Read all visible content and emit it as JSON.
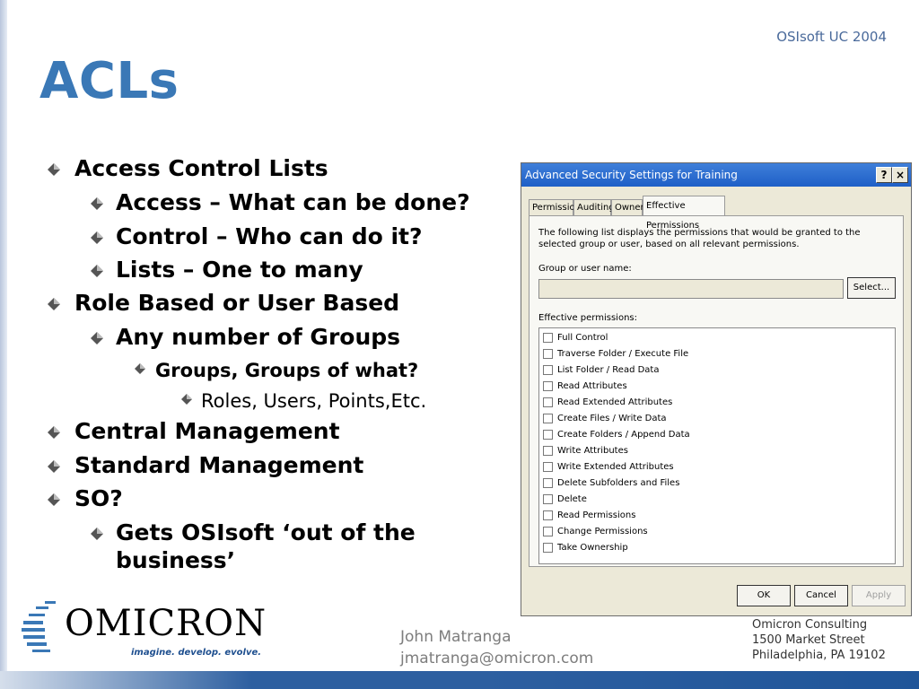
{
  "header": {
    "corner": "OSIsoft UC 2004",
    "title": "ACLs"
  },
  "bullets": {
    "b1": "Access Control Lists",
    "b1a": "Access – What can be done?",
    "b1b": "Control – Who can do it?",
    "b1c": "Lists – One to many",
    "b2": "Role Based or User Based",
    "b2a": "Any number of Groups",
    "b2a1": "Groups, Groups of what?",
    "b2a1a": "Roles, Users, Points,Etc.",
    "b3": "Central Management",
    "b4": "Standard Management",
    "b5": "SO?",
    "b5a_line1": "Gets OSIsoft ‘out of the",
    "b5a_line2": "business’"
  },
  "dialog": {
    "title": "Advanced Security Settings for Training",
    "help": "?",
    "close": "×",
    "tabs": [
      "Permissions",
      "Auditing",
      "Owner",
      "Effective Permissions"
    ],
    "description": "The following list displays the permissions that would be granted to the selected group or user, based on all relevant permissions.",
    "group_label": "Group or user name:",
    "group_value": "",
    "select_button": "Select...",
    "effective_label": "Effective permissions:",
    "permissions": [
      "Full Control",
      "Traverse Folder / Execute File",
      "List Folder / Read Data",
      "Read Attributes",
      "Read Extended Attributes",
      "Create Files / Write Data",
      "Create Folders / Append Data",
      "Write Attributes",
      "Write Extended Attributes",
      "Delete Subfolders and Files",
      "Delete",
      "Read Permissions",
      "Change Permissions",
      "Take Ownership"
    ],
    "ok": "OK",
    "cancel": "Cancel",
    "apply": "Apply"
  },
  "footer": {
    "logo_word": "OMICRON",
    "logo_tagline": "imagine. develop. evolve.",
    "name": "John Matranga",
    "email": "jmatranga@omicron.com",
    "addr1": "Omicron Consulting",
    "addr2": "1500 Market Street",
    "addr3": "Philadelphia, PA 19102"
  },
  "colors": {
    "title": "#3a78b6",
    "bar": "#2d5fa0"
  }
}
